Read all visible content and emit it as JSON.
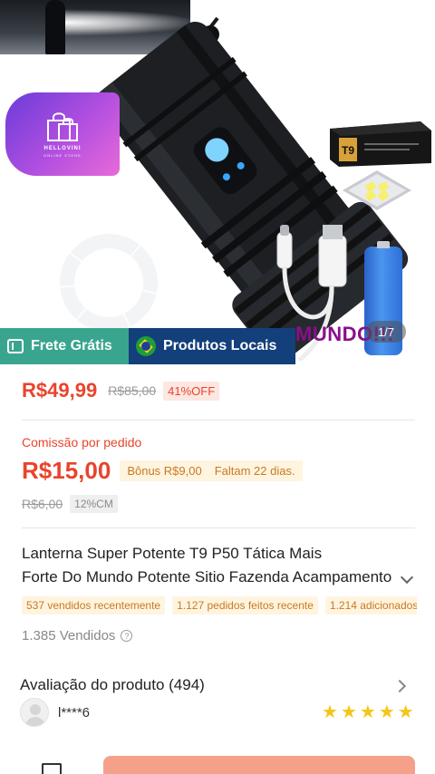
{
  "hero": {
    "brand_logo": {
      "name": "HELLOVINI",
      "sub": "ONLINE STORE",
      "icon": "shopping-bag-icon"
    },
    "package_label": "T9",
    "slogan": "MUNDO!!!",
    "page_counter": "1/7"
  },
  "badges": {
    "free_shipping": "Frete Grátis",
    "local_products": "Produtos Locais"
  },
  "price": {
    "current": "R$49,99",
    "original": "R$85,00",
    "discount": "41%OFF"
  },
  "commission": {
    "label": "Comissão por pedido",
    "value": "R$15,00",
    "bonus": "Bônus R$9,00",
    "days_left": "Faltam 22 dias.",
    "old_value": "R$6,00",
    "rate": "12%CM"
  },
  "product": {
    "title_line1": "Lanterna Super Potente T9 P50 Tática Mais",
    "title_line2": "Forte Do Mundo Potente Sitio Fazenda Acampamento"
  },
  "stats": [
    "537 vendidos recentemente",
    "1.127 pedidos feitos recente",
    "1.214 adicionados"
  ],
  "sold": {
    "text": "1.385 Vendidos",
    "info_icon": "?"
  },
  "rating": {
    "title": "Avaliação do produto (494)",
    "reviewer": "l****6",
    "stars": 5
  },
  "colors": {
    "price_red": "#e8442c",
    "free_shipping_green": "#3aa58e",
    "local_blue": "#133f7a",
    "tag_orange": "#c97a1e",
    "star_yellow": "#f5c518",
    "buy_button": "#f5a18a"
  }
}
